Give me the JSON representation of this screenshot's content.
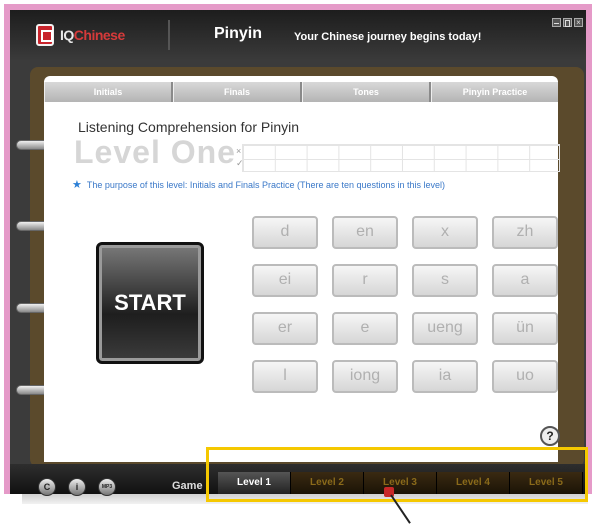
{
  "app": {
    "logo": "IQChinese",
    "title": "Pinyin",
    "tagline": "Your Chinese journey begins today!"
  },
  "window_controls": [
    "minimize-icon",
    "maximize-icon",
    "close-icon"
  ],
  "tabs": [
    "Initials",
    "Finals",
    "Tones",
    "Pinyin Practice"
  ],
  "header": {
    "title": "Listening Comprehension for Pinyin",
    "level": "Level One",
    "marks": [
      "×",
      "✓"
    ],
    "purpose": "The purpose of this level: Initials and Finals Practice (There are ten questions in this level)"
  },
  "start_label": "START",
  "keys": [
    "d",
    "en",
    "x",
    "zh",
    "ei",
    "r",
    "s",
    "a",
    "er",
    "e",
    "ueng",
    "ün",
    "l",
    "iong",
    "ia",
    "uo"
  ],
  "help_label": "?",
  "footer": {
    "icons": [
      {
        "label": "C"
      },
      {
        "label": "i"
      },
      {
        "label": "MP3"
      }
    ],
    "game_label": "Game",
    "levels": [
      "Level 1",
      "Level 2",
      "Level 3",
      "Level 4",
      "Level 5"
    ],
    "active_level": "Level 1"
  },
  "colors": {
    "frame": "#e59ac8",
    "highlight": "#f5c800",
    "purpose_text": "#3a78c8",
    "level_tab": "#8a6a1a"
  }
}
